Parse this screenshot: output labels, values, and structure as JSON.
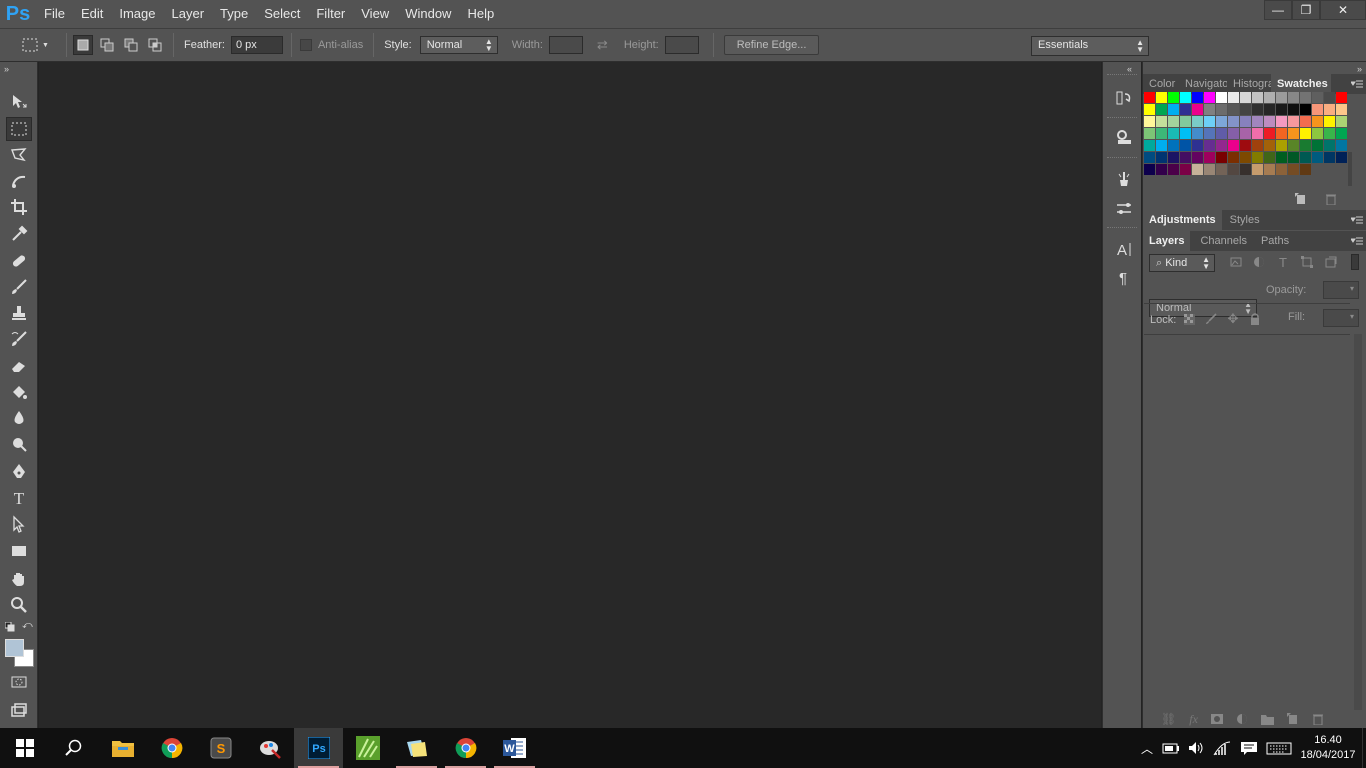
{
  "app": {
    "logo": "Ps"
  },
  "menu": [
    "File",
    "Edit",
    "Image",
    "Layer",
    "Type",
    "Select",
    "Filter",
    "View",
    "Window",
    "Help"
  ],
  "window_controls": {
    "minimize": "—",
    "restore": "❐",
    "close": "✕"
  },
  "options": {
    "feather_label": "Feather:",
    "feather_value": "0 px",
    "antialias_label": "Anti-alias",
    "style_label": "Style:",
    "style_value": "Normal",
    "width_label": "Width:",
    "height_label": "Height:",
    "refine_edge": "Refine Edge...",
    "workspace": "Essentials"
  },
  "top_panel": {
    "tabs": [
      "Color",
      "Navigato",
      "Histogra",
      "Swatches"
    ],
    "active_tab": "Swatches",
    "swatch_colors": [
      "#ff0000",
      "#ffff00",
      "#00ff00",
      "#00ffff",
      "#0000ff",
      "#ff00ff",
      "#ffffff",
      "#ebebeb",
      "#d7d7d7",
      "#c3c3c3",
      "#afafaf",
      "#9b9b9b",
      "#878787",
      "#737373",
      "#5f5f5f",
      "#4b4b4b",
      "#ff0000",
      "#ffff00",
      "#00a651",
      "#00aeef",
      "#2e3192",
      "#ec008c",
      "#808080",
      "#6c6c6c",
      "#585858",
      "#444444",
      "#303030",
      "#262626",
      "#1a1a1a",
      "#0f0f0f",
      "#000000",
      "#f79679",
      "#f9ad81",
      "#fdc68a",
      "#fff79a",
      "#c4df9b",
      "#a3d39c",
      "#82ca9c",
      "#7accc8",
      "#6dcff6",
      "#7da7d9",
      "#8393ca",
      "#8781bd",
      "#a186be",
      "#bd8cbf",
      "#f49ac1",
      "#f6989d",
      "#f26c4f",
      "#f7941d",
      "#fff200",
      "#acd373",
      "#7cc576",
      "#3cb878",
      "#1abbb4",
      "#00bff3",
      "#448ccb",
      "#5574b9",
      "#605ca8",
      "#855fa8",
      "#a763a8",
      "#f06eaa",
      "#ed1c24",
      "#f26522",
      "#f7941d",
      "#fff200",
      "#8dc63f",
      "#39b54a",
      "#00a651",
      "#00a99d",
      "#00aeef",
      "#0072bc",
      "#0054a6",
      "#2e3192",
      "#662d91",
      "#92278f",
      "#ec008c",
      "#9e0b0f",
      "#a0410d",
      "#a36209",
      "#aba000",
      "#598527",
      "#197b30",
      "#007236",
      "#00746b",
      "#0076a3",
      "#004b80",
      "#003471",
      "#1b1464",
      "#440e62",
      "#630460",
      "#9e005d",
      "#790000",
      "#7b2e00",
      "#7d4900",
      "#827b00",
      "#406618",
      "#005e20",
      "#005826",
      "#005952",
      "#005b7f",
      "#003663",
      "#002157",
      "#0d004c",
      "#32004b",
      "#4b0049",
      "#7b0046",
      "#c7b299",
      "#998675",
      "#736357",
      "#534741",
      "#37302d",
      "#c69c6d",
      "#a67c52",
      "#8c6239",
      "#754c24",
      "#603913"
    ]
  },
  "middle_panel": {
    "tabs": [
      "Adjustments",
      "Styles"
    ]
  },
  "layers_panel": {
    "tabs": [
      "Layers",
      "Channels",
      "Paths"
    ],
    "filter_kind": "Kind",
    "blend_mode": "Normal",
    "opacity_label": "Opacity:",
    "lock_label": "Lock:",
    "fill_label": "Fill:"
  },
  "taskbar": {
    "apps": [
      "start",
      "search",
      "file-explorer",
      "chrome",
      "sublime",
      "paint-app",
      "photoshop",
      "app-green",
      "sticky-notes",
      "chrome-2",
      "word"
    ],
    "time": "16.40",
    "date": "18/04/2017"
  }
}
